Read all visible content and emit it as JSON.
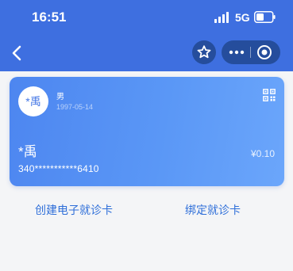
{
  "status_bar": {
    "time": "16:51",
    "network": "5G"
  },
  "nav": {
    "back_icon": "chevron-left-icon",
    "favorite_icon": "star-icon",
    "more_icon": "more-dots-icon",
    "close_icon": "target-circle-icon"
  },
  "card": {
    "avatar_text": "*禹",
    "gender": "男",
    "birthdate": "1997-05-14",
    "name": "*禹",
    "id_number": "340***********6410",
    "balance": "¥0.10",
    "qr_icon": "qr-code-icon"
  },
  "actions": {
    "create_label": "创建电子就诊卡",
    "bind_label": "绑定就诊卡"
  },
  "colors": {
    "header_bg": "#3e6fe0",
    "button_bg": "#254d9c",
    "card_start": "#4d86f0",
    "card_end": "#6ba6fb",
    "link": "#2f6fd9",
    "page_bg": "#f4f5f7"
  }
}
